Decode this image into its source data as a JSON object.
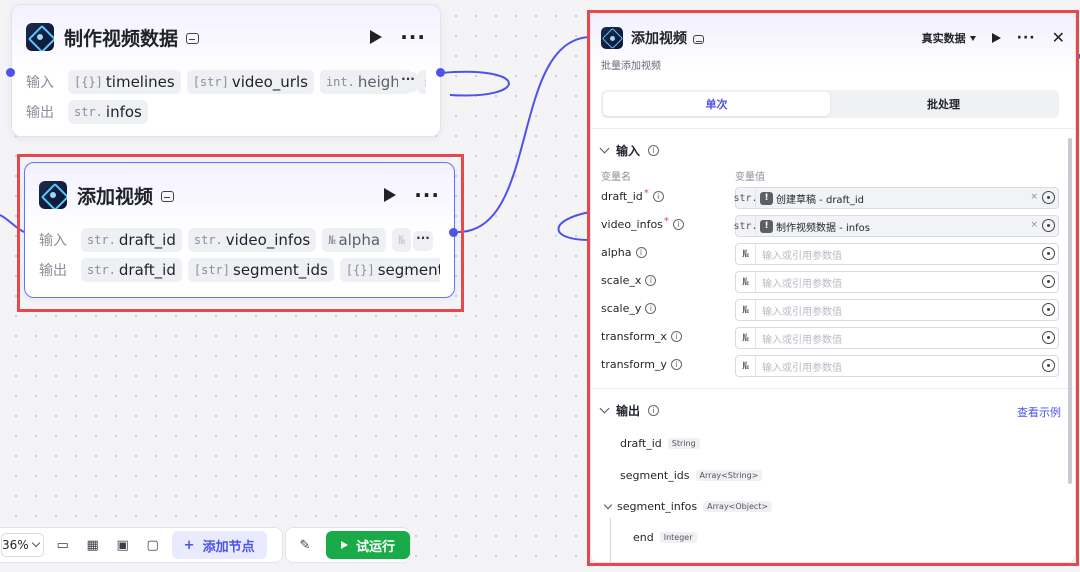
{
  "nodes": {
    "make_video_data": {
      "title": "制作视频数据",
      "input_label": "输入",
      "output_label": "输出",
      "inputs": [
        {
          "type": "[{}]",
          "name": "timelines"
        },
        {
          "type": "[str]",
          "name": "video_urls"
        },
        {
          "type": "int.",
          "name": "height"
        },
        {
          "type": "str",
          "name": ""
        }
      ],
      "outputs": [
        {
          "type": "str.",
          "name": "infos"
        }
      ],
      "overflow": "···"
    },
    "add_video": {
      "title": "添加视频",
      "input_label": "输入",
      "output_label": "输出",
      "inputs": [
        {
          "type": "str.",
          "name": "draft_id"
        },
        {
          "type": "str.",
          "name": "video_infos"
        },
        {
          "type": "№",
          "name": "alpha"
        },
        {
          "type": "№",
          "name": ""
        }
      ],
      "outputs": [
        {
          "type": "str.",
          "name": "draft_id"
        },
        {
          "type": "[str]",
          "name": "segment_ids"
        },
        {
          "type": "[{}]",
          "name": "segment_infos"
        }
      ],
      "overflow": "···"
    }
  },
  "toolbar": {
    "zoom": "36%",
    "add_node": "添加节点",
    "run": "试运行",
    "plus": "+"
  },
  "panel": {
    "title": "添加视频",
    "subtitle": "批量添加视频",
    "real_data": "真实数据",
    "tabs": [
      "单次",
      "批处理"
    ],
    "input_section": "输入",
    "col_name": "变量名",
    "col_value": "变量值",
    "params": [
      {
        "name": "draft_id",
        "required": "*",
        "type": "str.",
        "ref": "创建草稿 - draft_id",
        "clear": "×"
      },
      {
        "name": "video_infos",
        "required": "*",
        "type": "str.",
        "ref": "制作视频数据 - infos",
        "clear": "×"
      },
      {
        "name": "alpha",
        "required": "",
        "type": "№",
        "placeholder": "输入或引用参数值"
      },
      {
        "name": "scale_x",
        "required": "",
        "type": "№",
        "placeholder": "输入或引用参数值"
      },
      {
        "name": "scale_y",
        "required": "",
        "type": "№",
        "placeholder": "输入或引用参数值"
      },
      {
        "name": "transform_x",
        "required": "",
        "type": "№",
        "placeholder": "输入或引用参数值"
      },
      {
        "name": "transform_y",
        "required": "",
        "type": "№",
        "placeholder": "输入或引用参数值"
      }
    ],
    "output_section": "输出",
    "view_example": "查看示例",
    "outputs": [
      {
        "name": "draft_id",
        "type": "String"
      },
      {
        "name": "segment_ids",
        "type": "Array<String>"
      },
      {
        "name": "segment_infos",
        "type": "Array<Object>"
      },
      {
        "name": "end",
        "type": "Integer"
      }
    ]
  },
  "colors": {
    "accent": "#4d53e8",
    "highlight": "#e5484d",
    "run": "#1aaa4a"
  }
}
